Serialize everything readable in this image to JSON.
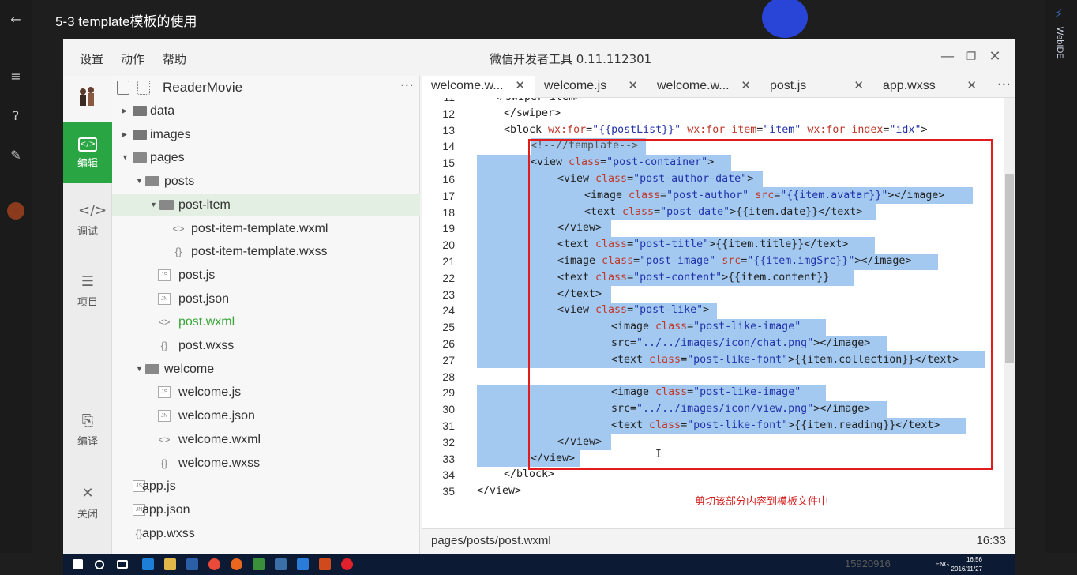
{
  "player": {
    "title": "5-3 template模板的使用",
    "side_label": "WebIDE",
    "watermark": "15920916"
  },
  "window": {
    "menus": [
      "设置",
      "动作",
      "帮助"
    ],
    "title": "微信开发者工具 0.11.112301"
  },
  "activity": [
    {
      "label": "编辑",
      "icon": "code-icon",
      "active": true
    },
    {
      "label": "调试",
      "icon": "debug-icon",
      "active": false
    },
    {
      "label": "项目",
      "icon": "list-icon",
      "active": false
    },
    {
      "label": "编译",
      "icon": "compile-icon",
      "active": false
    },
    {
      "label": "关闭",
      "icon": "close-icon",
      "active": false
    }
  ],
  "tree": {
    "project": "ReaderMovie",
    "items": [
      {
        "label": "data",
        "kind": "folder",
        "depth": 0,
        "expanded": false
      },
      {
        "label": "images",
        "kind": "folder",
        "depth": 0,
        "expanded": false
      },
      {
        "label": "pages",
        "kind": "folder",
        "depth": 0,
        "expanded": true
      },
      {
        "label": "posts",
        "kind": "folder",
        "depth": 1,
        "expanded": true
      },
      {
        "label": "post-item",
        "kind": "folder",
        "depth": 2,
        "expanded": true,
        "selected": true
      },
      {
        "label": "post-item-template.wxml",
        "kind": "wxml",
        "depth": 3
      },
      {
        "label": "post-item-template.wxss",
        "kind": "wxss",
        "depth": 3
      },
      {
        "label": "post.js",
        "kind": "js",
        "depth": 2
      },
      {
        "label": "post.json",
        "kind": "json",
        "depth": 2
      },
      {
        "label": "post.wxml",
        "kind": "wxml",
        "depth": 2,
        "active": true
      },
      {
        "label": "post.wxss",
        "kind": "wxss",
        "depth": 2
      },
      {
        "label": "welcome",
        "kind": "folder",
        "depth": 1,
        "expanded": true
      },
      {
        "label": "welcome.js",
        "kind": "js",
        "depth": 2
      },
      {
        "label": "welcome.json",
        "kind": "json",
        "depth": 2
      },
      {
        "label": "welcome.wxml",
        "kind": "wxml",
        "depth": 2
      },
      {
        "label": "welcome.wxss",
        "kind": "wxss",
        "depth": 2
      },
      {
        "label": "app.js",
        "kind": "js",
        "depth": 0
      },
      {
        "label": "app.json",
        "kind": "json",
        "depth": 0
      },
      {
        "label": "app.wxss",
        "kind": "wxss",
        "depth": 0
      }
    ]
  },
  "tabs": [
    {
      "label": "welcome.w...",
      "active": true
    },
    {
      "label": "welcome.js",
      "active": false
    },
    {
      "label": "welcome.w...",
      "active": false
    },
    {
      "label": "post.js",
      "active": false
    },
    {
      "label": "app.wxss",
      "active": false
    }
  ],
  "code": {
    "lines": [
      {
        "n": "11",
        "text": "</swiper-item>"
      },
      {
        "n": "12",
        "text": "</swiper>"
      },
      {
        "n": "13",
        "text": "<block wx:for=\"{{postList}}\" wx:for-item=\"item\" wx:for-index=\"idx\">"
      },
      {
        "n": "14",
        "text": "<!--//template-->"
      },
      {
        "n": "15",
        "text": "<view class=\"post-container\">"
      },
      {
        "n": "16",
        "text": "<view class=\"post-author-date\">"
      },
      {
        "n": "17",
        "text": "<image class=\"post-author\" src=\"{{item.avatar}}\"></image>"
      },
      {
        "n": "18",
        "text": "<text class=\"post-date\">{{item.date}}</text>"
      },
      {
        "n": "19",
        "text": "</view>"
      },
      {
        "n": "20",
        "text": "<text class=\"post-title\">{{item.title}}</text>"
      },
      {
        "n": "21",
        "text": "<image class=\"post-image\" src=\"{{item.imgSrc}}\"></image>"
      },
      {
        "n": "22",
        "text": "<text class=\"post-content\">{{item.content}}"
      },
      {
        "n": "23",
        "text": "</text>"
      },
      {
        "n": "24",
        "text": "<view class=\"post-like\">"
      },
      {
        "n": "25",
        "text": "<image class=\"post-like-image\""
      },
      {
        "n": "26",
        "text": "src=\"../../images/icon/chat.png\"></image>"
      },
      {
        "n": "27",
        "text": "<text class=\"post-like-font\">{{item.collection}}</text>"
      },
      {
        "n": "28",
        "text": ""
      },
      {
        "n": "29",
        "text": "<image class=\"post-like-image\""
      },
      {
        "n": "30",
        "text": "src=\"../../images/icon/view.png\"></image>"
      },
      {
        "n": "31",
        "text": "<text class=\"post-like-font\">{{item.reading}}</text>"
      },
      {
        "n": "32",
        "text": "</view>"
      },
      {
        "n": "33",
        "text": "</view>"
      },
      {
        "n": "34",
        "text": "</block>"
      },
      {
        "n": "35",
        "text": "</view>"
      }
    ],
    "annotation": "剪切该部分内容到模板文件中"
  },
  "status": {
    "path": "pages/posts/post.wxml",
    "position": "16:33"
  },
  "taskbar": {
    "lang": "ENG",
    "time": "16:56",
    "date": "2016/11/27"
  },
  "colors": {
    "accent_green": "#2aa543",
    "selection": "#a3c9f1",
    "annotation_red": "#e21b1b",
    "record_blue": "#2845d8"
  }
}
